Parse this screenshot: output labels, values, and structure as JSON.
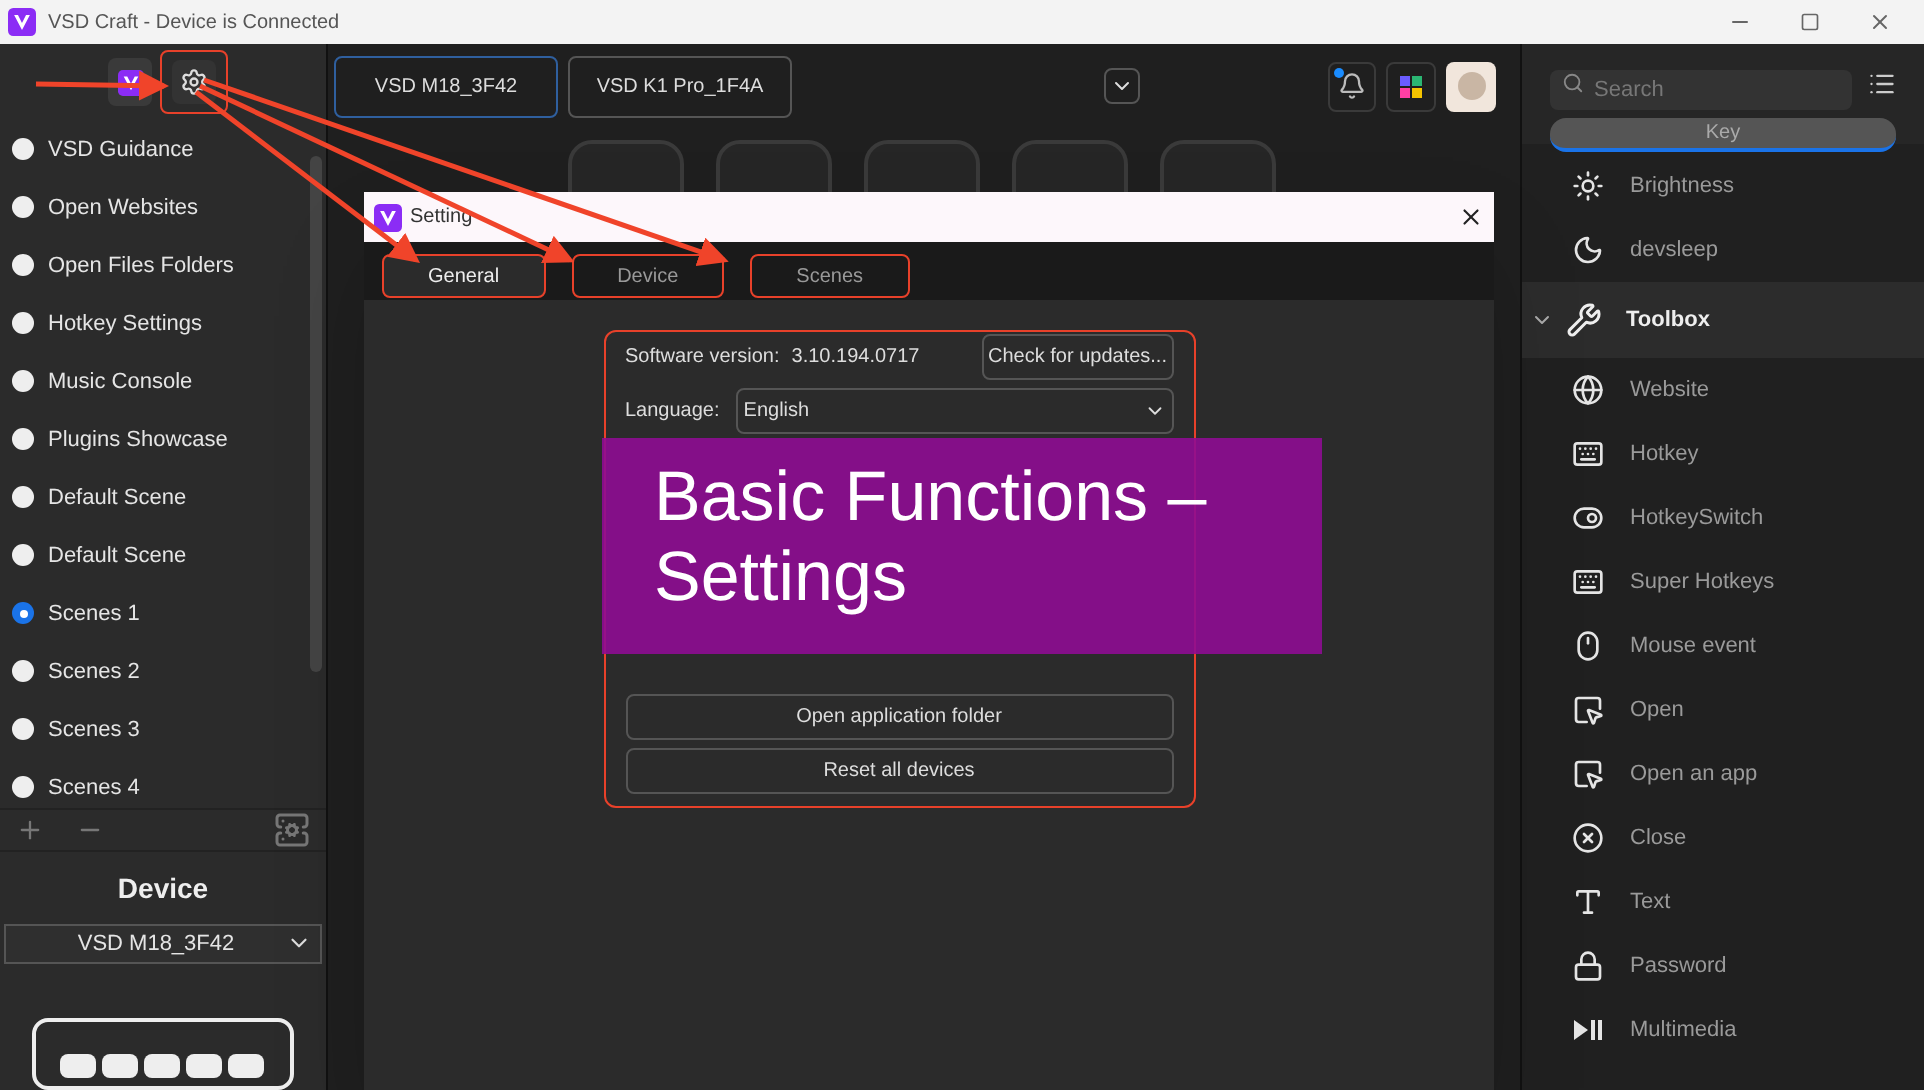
{
  "window": {
    "title": "VSD Craft - Device is Connected"
  },
  "sidebar": {
    "scenes": [
      {
        "label": "VSD Guidance",
        "selected": false
      },
      {
        "label": "Open Websites",
        "selected": false
      },
      {
        "label": "Open Files Folders",
        "selected": false
      },
      {
        "label": "Hotkey Settings",
        "selected": false
      },
      {
        "label": "Music Console",
        "selected": false
      },
      {
        "label": "Plugins Showcase",
        "selected": false
      },
      {
        "label": "Default Scene",
        "selected": false
      },
      {
        "label": "Default Scene",
        "selected": false
      },
      {
        "label": "Scenes 1",
        "selected": true
      },
      {
        "label": "Scenes 2",
        "selected": false
      },
      {
        "label": "Scenes 3",
        "selected": false
      },
      {
        "label": "Scenes 4",
        "selected": false
      }
    ],
    "device_heading": "Device",
    "device_select": {
      "value": "VSD M18_3F42"
    }
  },
  "device_tabs": [
    {
      "label": "VSD M18_3F42",
      "selected": true
    },
    {
      "label": "VSD K1 Pro_1F4A",
      "selected": false
    }
  ],
  "notifications": {
    "unread": true
  },
  "dialog": {
    "title": "Setting",
    "tabs": [
      {
        "label": "General",
        "selected": true
      },
      {
        "label": "Device",
        "selected": false
      },
      {
        "label": "Scenes",
        "selected": false
      }
    ],
    "software_version_label": "Software version:",
    "software_version": "3.10.194.0717",
    "check_updates_button": "Check for updates...",
    "language_label": "Language:",
    "language_value": "English",
    "buttons": [
      {
        "label": "Open application folder"
      },
      {
        "label": "Reset all devices"
      }
    ]
  },
  "banner": {
    "text": "Basic Functions – Settings"
  },
  "right_panel": {
    "search": {
      "placeholder": "Search"
    },
    "tabs": [
      {
        "label": "Key",
        "selected": true
      }
    ],
    "items": [
      {
        "label": "Brightness"
      },
      {
        "label": "devsleep"
      }
    ],
    "groups": [
      {
        "label": "Toolbox",
        "expanded": true,
        "items": [
          {
            "label": "Website"
          },
          {
            "label": "Hotkey"
          },
          {
            "label": "HotkeySwitch"
          },
          {
            "label": "Super Hotkeys"
          },
          {
            "label": "Mouse event"
          },
          {
            "label": "Open"
          },
          {
            "label": "Open an app"
          },
          {
            "label": "Close"
          },
          {
            "label": "Text"
          },
          {
            "label": "Password"
          },
          {
            "label": "Multimedia"
          }
        ]
      }
    ]
  }
}
